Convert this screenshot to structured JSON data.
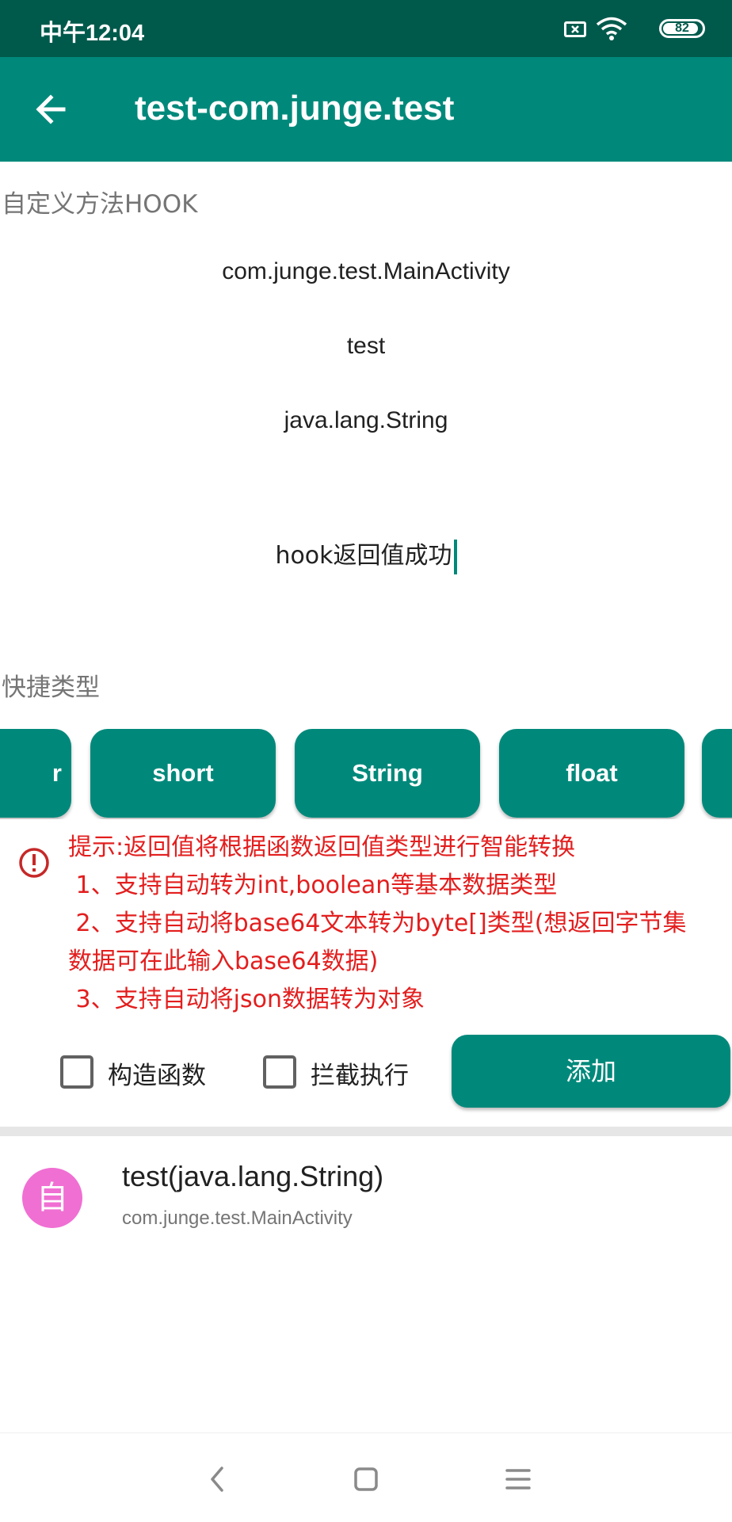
{
  "status_bar": {
    "time": "中午12:04",
    "battery": "82",
    "icons": [
      "sim-icon",
      "wifi-icon",
      "battery-icon"
    ]
  },
  "app_bar": {
    "title": "test-com.junge.test",
    "back_icon": "arrow-left-icon"
  },
  "hook_form": {
    "section_label": "自定义方法HOOK",
    "class_name": "com.junge.test.MainActivity",
    "method_name": "test",
    "param_types": "java.lang.String",
    "return_value": "hook返回值成功"
  },
  "quick_types": {
    "section_label": "快捷类型",
    "chips": [
      "r",
      "short",
      "String",
      "float",
      ""
    ]
  },
  "tip": {
    "icon": "alert-circle-icon",
    "color": "#e31e1e",
    "lines": [
      "提示:返回值将根据函数返回值类型进行智能转换",
      " 1、支持自动转为int,boolean等基本数据类型",
      " 2、支持自动将base64文本转为byte[]类型(想返回字节集",
      "数据可在此输入base64数据)",
      " 3、支持自动将json数据转为对象"
    ]
  },
  "options": {
    "constructor_label": "构造函数",
    "constructor_checked": false,
    "intercept_label": "拦截执行",
    "intercept_checked": false,
    "add_button": "添加"
  },
  "hook_list": [
    {
      "avatar": "自",
      "title": "test(java.lang.String)",
      "subtitle": "com.junge.test.MainActivity"
    }
  ],
  "nav_bar": {
    "icons": [
      "back-nav-icon",
      "home-nav-icon",
      "menu-nav-icon"
    ]
  },
  "colors": {
    "primary": "#00897b",
    "status_bar": "#005a4c",
    "avatar": "#f06fd3",
    "warning_text": "#e31e1e"
  }
}
